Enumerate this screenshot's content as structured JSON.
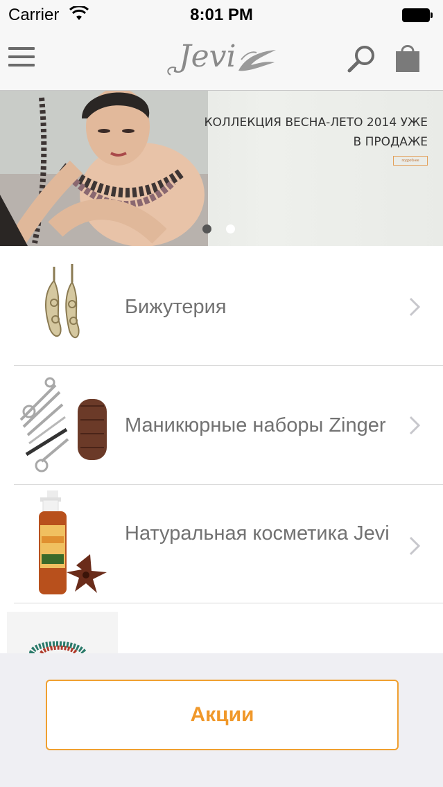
{
  "status_bar": {
    "carrier": "Carrier",
    "time": "8:01 PM",
    "icons": [
      "wifi-icon",
      "battery-icon"
    ]
  },
  "nav": {
    "logo_text": "Jevi",
    "icons": [
      "hamburger-menu-icon",
      "search-icon",
      "shopping-bag-icon"
    ],
    "icon_color": "#6b6b6b"
  },
  "banner": {
    "title": "КОЛЛЕКЦИЯ ВЕСНА-ЛЕТО 2014 УЖЕ В ПРОДАЖЕ",
    "button_label": "подробнее",
    "pager": {
      "total": 2,
      "active": 1
    }
  },
  "categories": [
    {
      "label": "Бижутерия",
      "thumb": "earrings-image"
    },
    {
      "label": "Маникюрные наборы Zinger",
      "thumb": "manicure-set-image"
    },
    {
      "label": "Натуральная косметика Jevi",
      "thumb": "cosmetics-bottle-image"
    },
    {
      "label": "",
      "thumb": "hair-ties-image"
    }
  ],
  "promo": {
    "label": "Акции",
    "accent_color": "#f0982a"
  }
}
